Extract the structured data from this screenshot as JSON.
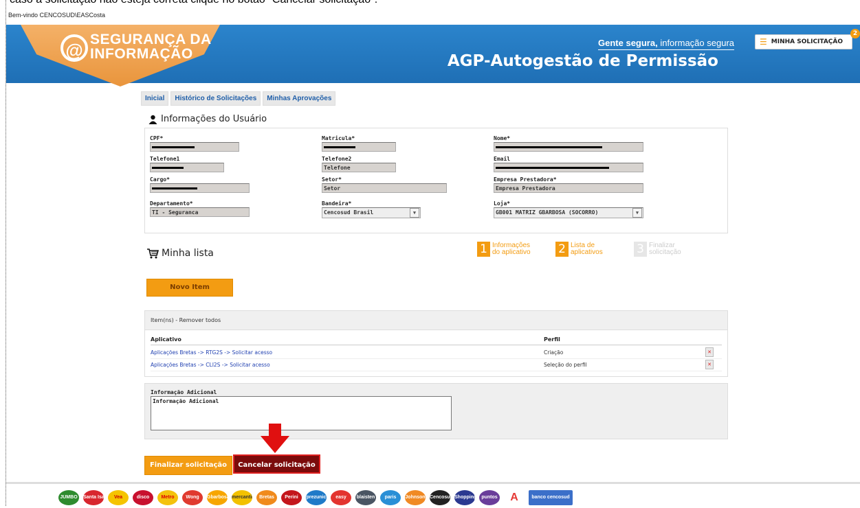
{
  "top_caption": "caso a solicitação não esteja correta clique no botão \"Cancelar solicitação\".",
  "welcome": "Bem-vindo CENCOSUD\\EASCosta",
  "header": {
    "logo_line1": "SEGURANÇA DA",
    "logo_line2": "INFORMAÇÃO",
    "tagline_bold": "Gente segura,",
    "tagline_rest": " informação segura",
    "app_title": "AGP-Autogestão de Permissão",
    "my_request_label": "MINHA SOLICITAÇÃO",
    "badge_count": "2",
    "accent": "#f39c12",
    "header_blue": "#2178c0"
  },
  "tabs": [
    "Inicial",
    "Histórico de Solicitações",
    "Minhas Aprovações"
  ],
  "user_info": {
    "title": "Informações do Usuário",
    "fields": {
      "cpf": {
        "label": "CPF*",
        "value": ""
      },
      "matricula": {
        "label": "Matricula*",
        "value": ""
      },
      "nome": {
        "label": "Nome*",
        "value": ""
      },
      "telefone1": {
        "label": "Telefone1",
        "value": ""
      },
      "telefone2": {
        "label": "Telefone2",
        "value": "Telefone"
      },
      "email": {
        "label": "Email",
        "value": ""
      },
      "cargo": {
        "label": "Cargo*",
        "value": ""
      },
      "setor": {
        "label": "Setor*",
        "value": "Setor"
      },
      "empresa": {
        "label": "Empresa Prestadora*",
        "value": "Empresa Prestadora"
      },
      "departamento": {
        "label": "Departamento*",
        "value": "TI - Seguranca"
      },
      "bandeira": {
        "label": "Bandeira*",
        "value": "Cencosud Brasil"
      },
      "loja": {
        "label": "Loja*",
        "value": "GB001 MATRIZ GBARBOSA (SOCORRO)"
      }
    }
  },
  "cart": {
    "title": "Minha lista",
    "new_item_label": "Novo Item",
    "steps": [
      {
        "num": "1",
        "line1": "Informações",
        "line2": "do aplicativo"
      },
      {
        "num": "2",
        "line1": "Lista de",
        "line2": "aplicativos"
      },
      {
        "num": "3",
        "line1": "Finalizar",
        "line2": "solicitação"
      }
    ]
  },
  "items": {
    "header": "Item(ns) - Remover todos",
    "col_app": "Aplicativo",
    "col_profile": "Perfil",
    "rows": [
      {
        "app": "Aplicações Bretas -> RTG2S -> Solicitar acesso",
        "profile": "Criação"
      },
      {
        "app": "Aplicações Bretas -> CLI2S -> Solicitar acesso",
        "profile": "Seleção do perfil"
      }
    ]
  },
  "additional": {
    "label": "Informação Adicional",
    "value": "Informação Adicional"
  },
  "actions": {
    "finalize_label": "Finalizar solicitação",
    "cancel_label": "Cancelar solicitação"
  },
  "footer_brands": [
    "JUMBO",
    "Santa Isabel",
    "Vea",
    "disco",
    "Metro",
    "Wong",
    "Gbarbosa",
    "mercantil",
    "Bretas",
    "Perini",
    "prezunic",
    "easy",
    "blaisten",
    "paris",
    "Johnson",
    "Cencosud Shopping",
    "Shopping",
    "puntos",
    "A",
    "banco cencosud"
  ]
}
